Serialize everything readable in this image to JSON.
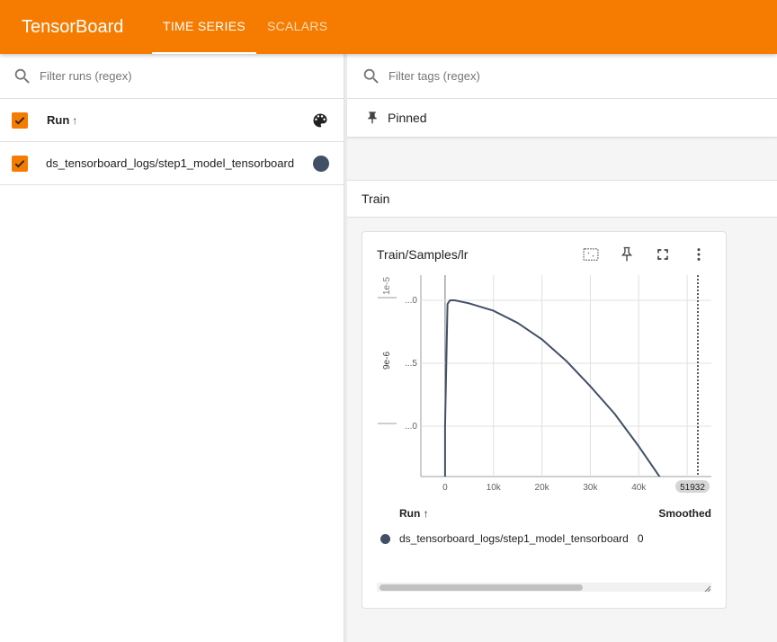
{
  "app": {
    "title": "TensorBoard",
    "accent_color": "#f57c00"
  },
  "tabs": [
    {
      "label": "TIME SERIES",
      "active": true
    },
    {
      "label": "SCALARS",
      "active": false
    }
  ],
  "sidebar": {
    "run_filter_placeholder": "Filter runs (regex)",
    "header_label": "Run",
    "sort_icon": "arrow-upward-icon",
    "runs": [
      {
        "name": "ds_tensorboard_logs/step1_model_tensorboard",
        "checked": true,
        "color": "#425066"
      }
    ]
  },
  "main": {
    "tag_filter_placeholder": "Filter tags (regex)",
    "pinned_label": "Pinned",
    "group_title": "Train",
    "card": {
      "title": "Train/Samples/lr",
      "legend": {
        "run_header": "Run",
        "smoothed_header": "Smoothed",
        "rows": [
          {
            "run": "ds_tensorboard_logs/step1_model_tensorboard",
            "smoothed": "0",
            "color": "#425066"
          }
        ]
      }
    }
  },
  "chart_data": {
    "type": "line",
    "title": "Train/Samples/lr",
    "x_tick_labels": [
      "0",
      "10k",
      "20k",
      "30k",
      "40k"
    ],
    "y_tick_labels": [
      "...0",
      "...5",
      "...0"
    ],
    "y_axis_scale_labels": [
      "1e-5",
      "9e-6"
    ],
    "xlim": [
      -5000,
      55000
    ],
    "cursor_x_label": "51932",
    "grid": true,
    "series": [
      {
        "color": "#425066",
        "x": [
          0,
          500,
          1000,
          2000,
          5000,
          10000,
          15000,
          20000,
          25000,
          30000,
          35000,
          40000,
          45000,
          50000
        ],
        "y_frac": [
          0.0,
          0.97,
          1.0,
          1.0,
          0.976,
          0.917,
          0.82,
          0.69,
          0.52,
          0.317,
          0.1,
          -0.16,
          -0.44,
          -0.76
        ]
      }
    ]
  }
}
